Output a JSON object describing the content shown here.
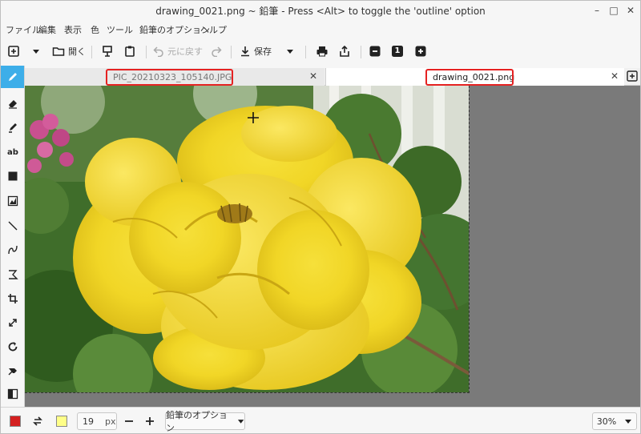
{
  "window": {
    "title": "drawing_0021.png ~ 鉛筆 - Press <Alt> to toggle the 'outline' option",
    "minimize_label": "–",
    "maximize_label": "□",
    "close_label": "✕"
  },
  "menu": [
    "ファイル",
    "編集",
    "表示",
    "色",
    "ツール",
    "鉛筆のオプション",
    "ヘルプ"
  ],
  "toolbar": {
    "open_label": "開く",
    "undo_label": "元に戻す",
    "save_label": "保存",
    "zoom_value": "1"
  },
  "tabs": [
    {
      "label": "PIC_20210323_105140.JPG",
      "close": "✕"
    },
    {
      "label": "drawing_0021.png",
      "close": "✕"
    }
  ],
  "tools": [
    {
      "name": "pencil-icon",
      "glyph": ""
    },
    {
      "name": "eraser-icon",
      "glyph": ""
    },
    {
      "name": "highlighter-icon",
      "glyph": ""
    },
    {
      "name": "text-tool",
      "glyph": "ab"
    },
    {
      "name": "rectangle-icon",
      "glyph": ""
    },
    {
      "name": "shape-icon",
      "glyph": ""
    },
    {
      "name": "line-icon",
      "glyph": ""
    },
    {
      "name": "curve-icon",
      "glyph": ""
    },
    {
      "name": "freeshape-icon",
      "glyph": ""
    },
    {
      "name": "crop-icon",
      "glyph": ""
    },
    {
      "name": "scale-icon",
      "glyph": ""
    },
    {
      "name": "rotate-icon",
      "glyph": ""
    },
    {
      "name": "filters-icon",
      "glyph": ""
    },
    {
      "name": "contrast-icon",
      "glyph": ""
    }
  ],
  "bottom": {
    "primary_color": "#d42020",
    "secondary_color": "#ffff88",
    "size_value": "19",
    "size_unit": "px",
    "options_label": "鉛筆のオプション",
    "zoom_value": "30%"
  }
}
